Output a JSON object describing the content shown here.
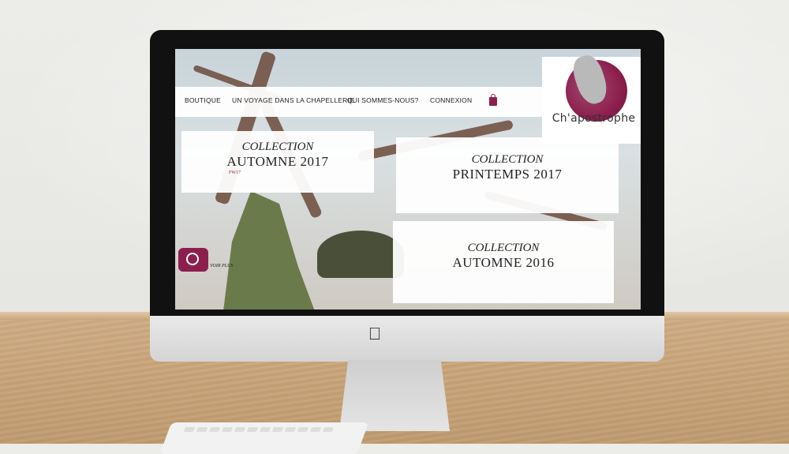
{
  "site": {
    "nav": {
      "items": [
        {
          "label": "BOUTIQUE"
        },
        {
          "label": "UN VOYAGE DANS LA CHAPELLERIE"
        },
        {
          "label": "QUI SOMMES-NOUS?"
        },
        {
          "label": "CONNEXION"
        }
      ],
      "cart_icon": "shopping-bag-icon"
    },
    "logo": {
      "text": "Ch'apostrophe",
      "color": "#8d1f4e"
    },
    "tiles": [
      {
        "line1": "COLLECTION",
        "line2": "AUTOMNE 2017",
        "tag": "FW17"
      },
      {
        "line1": "COLLECTION",
        "line2": "PRINTEMPS 2017"
      },
      {
        "line1": "COLLECTION",
        "line2": "AUTOMNE 2016"
      }
    ],
    "gallery": {
      "icon": "camera-icon",
      "label": "VOIR PLUS"
    }
  }
}
